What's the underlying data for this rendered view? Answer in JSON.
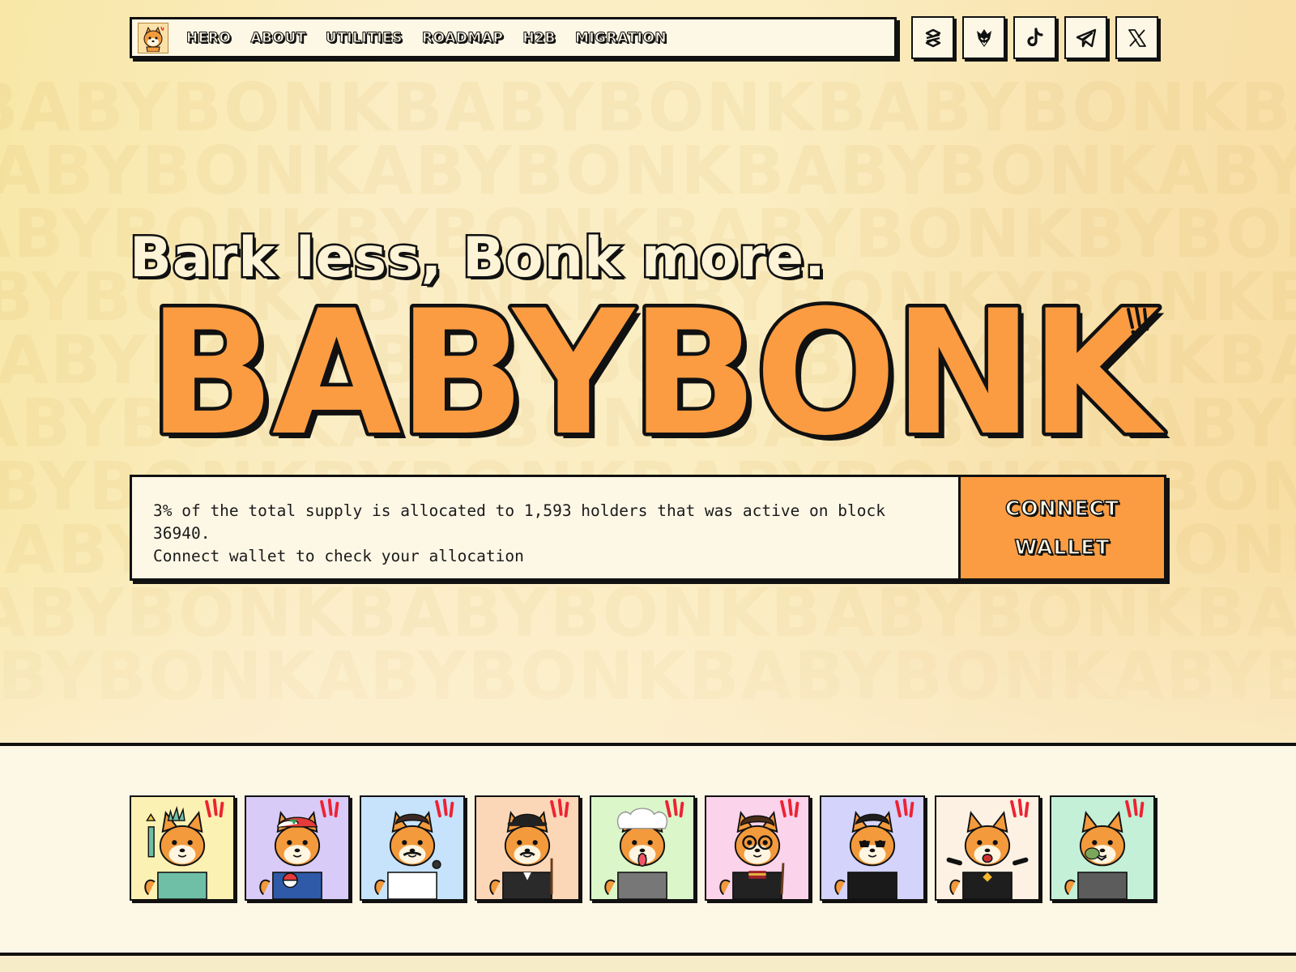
{
  "nav": {
    "logo_alt": "babybonk-logo",
    "links": [
      "HERO",
      "ABOUT",
      "UTILITIES",
      "ROADMAP",
      "H2B",
      "MIGRATION"
    ]
  },
  "socials": [
    {
      "name": "dextools-icon"
    },
    {
      "name": "birdeye-icon"
    },
    {
      "name": "tiktok-icon"
    },
    {
      "name": "telegram-icon"
    },
    {
      "name": "x-icon"
    }
  ],
  "hero": {
    "tagline": "Bark less, Bonk more.",
    "brand": "BABYBONK",
    "brand_color": "#fb9c42",
    "background_text": "BABYBONK"
  },
  "allocation": {
    "line1": "3% of the total supply is allocated to 1,593 holders that was active on block 36940.",
    "line2": "Connect wallet to check your allocation",
    "button_line1": "CONNECT",
    "button_line2": "WALLET"
  },
  "cards": [
    {
      "name": "statue-of-liberty-pup",
      "bg": "#fbf1b3"
    },
    {
      "name": "ash-trainer-pup",
      "bg": "#d9cbf7"
    },
    {
      "name": "singer-pup",
      "bg": "#c6e3fb"
    },
    {
      "name": "bowler-hat-pup",
      "bg": "#fbd7b8"
    },
    {
      "name": "einstein-pup",
      "bg": "#dbf6c9"
    },
    {
      "name": "wizard-pup",
      "bg": "#fbd3ea"
    },
    {
      "name": "sunglasses-pup",
      "bg": "#d3d3fb"
    },
    {
      "name": "binance-pup",
      "bg": "#fdf1e3"
    },
    {
      "name": "zombie-pup",
      "bg": "#c4f0d7"
    }
  ]
}
